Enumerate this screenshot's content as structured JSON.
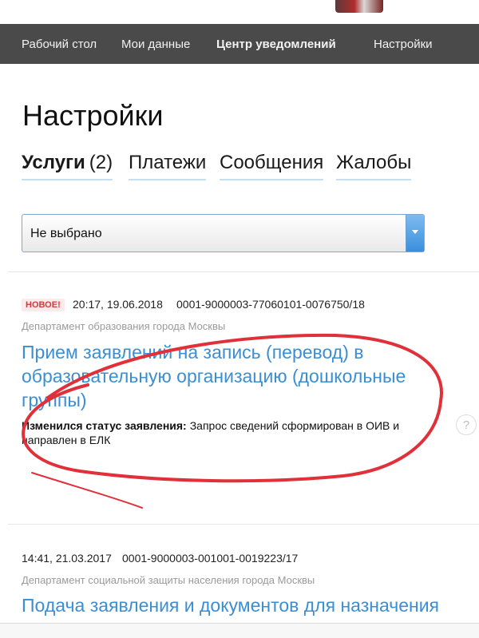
{
  "nav": {
    "items": [
      {
        "label": "Рабочий стол",
        "active": false
      },
      {
        "label": "Мои данные",
        "active": false
      },
      {
        "label": "Центр уведомлений",
        "active": true
      },
      {
        "label": "Настройки",
        "active": false
      }
    ]
  },
  "page": {
    "title": "Настройки"
  },
  "tabs": [
    {
      "label": "Услуги",
      "count": "(2)",
      "active": true
    },
    {
      "label": "Платежи",
      "count": "",
      "active": false
    },
    {
      "label": "Сообщения",
      "count": "",
      "active": false
    },
    {
      "label": "Жалобы",
      "count": "",
      "active": false
    }
  ],
  "filter": {
    "selected": "Не выбрано"
  },
  "notifications": [
    {
      "badge": "НОВОЕ!",
      "datetime": "20:17, 19.06.2018",
      "number": "0001-9000003-77060101-0076750/18",
      "department": "Департамент образования города Москвы",
      "title": "Прием заявлений на запись (перевод) в образовательную организацию (дошкольные группы)",
      "status_label": "Изменился статус заявления:",
      "status_text": "Запрос сведений сформирован в ОИВ и направлен в ЕЛК"
    },
    {
      "badge": "",
      "datetime": "14:41, 21.03.2017",
      "number": "0001-9000003-001001-0019223/17",
      "department": "Департамент социальной защиты населения города Москвы",
      "title": "Подача заявления и документов для назначения"
    }
  ],
  "colors": {
    "nav_bg": "#4a4a4a",
    "link": "#3b8ed3",
    "badge": "#d03a3a",
    "scribble": "#e0303a"
  }
}
